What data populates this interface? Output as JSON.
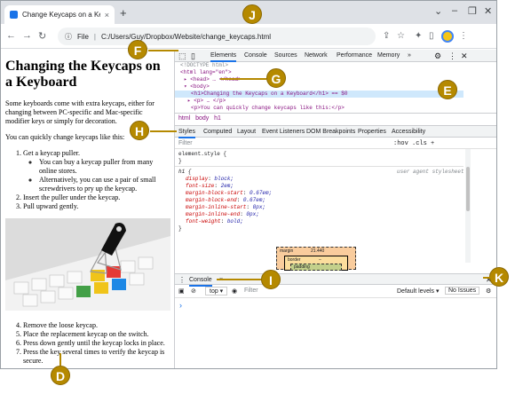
{
  "browser": {
    "tab_title": "Change Keycaps on a Keyboard",
    "tab_close": "×",
    "new_tab": "+",
    "address": "C:/Users/Guy/Dropbox/Website/change_keycaps.html",
    "address_prefix": "File"
  },
  "page": {
    "heading": "Changing the Keycaps on a Keyboard",
    "intro": "Some keyboards come with extra keycaps, either for changing between PC-specific and Mac-specific modifier keys or simply for decoration.",
    "lead": "You can quickly change keycaps like this:",
    "steps_a": [
      "Get a keycap puller.",
      "Insert the puller under the keycap.",
      "Pull upward gently."
    ],
    "substeps": [
      "You can buy a keycap puller from many online stores.",
      "Alternatively, you can use a pair of small screwdrivers to pry up the keycap."
    ],
    "steps_b": [
      "Remove the loose keycap.",
      "Place the replacement keycap on the switch.",
      "Press down gently until the keycap locks in place.",
      "Press the key several times to verify the keycap is secure."
    ]
  },
  "devtools": {
    "top_tabs": [
      "Elements",
      "Console",
      "Sources",
      "Network",
      "Performance",
      "Memory",
      "»"
    ],
    "dom_lines": [
      "<!DOCTYPE html>",
      "<html lang=\"en\">",
      "▸ <head> … </head>",
      "▾ <body>",
      "<h1>Changing the Keycaps on a Keyboard</h1> == $0",
      "▸ <p> … </p>",
      "<p>You can quickly change keycaps like this:</p>"
    ],
    "breadcrumbs": [
      "html",
      "body",
      "h1"
    ],
    "styles_tabs": [
      "Styles",
      "Computed",
      "Layout",
      "Event Listeners",
      "DOM Breakpoints",
      "Properties",
      "Accessibility"
    ],
    "filter_placeholder": "Filter",
    "filter_buttons": ":hov  .cls  +",
    "element_style": "element.style {",
    "close_brace": "}",
    "rule_selector": "h1 {",
    "rule_source": "user agent stylesheet",
    "declarations": [
      {
        "p": "display",
        "v": "block;"
      },
      {
        "p": "font-size",
        "v": "2em;"
      },
      {
        "p": "margin-block-start",
        "v": "0.67em;"
      },
      {
        "p": "margin-block-end",
        "v": "0.67em;"
      },
      {
        "p": "margin-inline-start",
        "v": "0px;"
      },
      {
        "p": "margin-inline-end",
        "v": "0px;"
      },
      {
        "p": "font-weight",
        "v": "bold;"
      }
    ],
    "box_model": {
      "margin": "margin",
      "margin_value": "21.440",
      "border": "border",
      "border_value": "–",
      "padding": "padding"
    },
    "drawer_tab": "Console",
    "console_context": "top ▾",
    "console_filter": "Filter",
    "default_levels": "Default levels ▾",
    "no_issues": "No Issues",
    "prompt": "›"
  },
  "callouts": {
    "d": "D",
    "e": "E",
    "f": "F",
    "g": "G",
    "h": "H",
    "i": "I",
    "j": "J",
    "k": "K"
  },
  "colors": {
    "badge": "#b58900",
    "accent": "#1a73e8"
  }
}
